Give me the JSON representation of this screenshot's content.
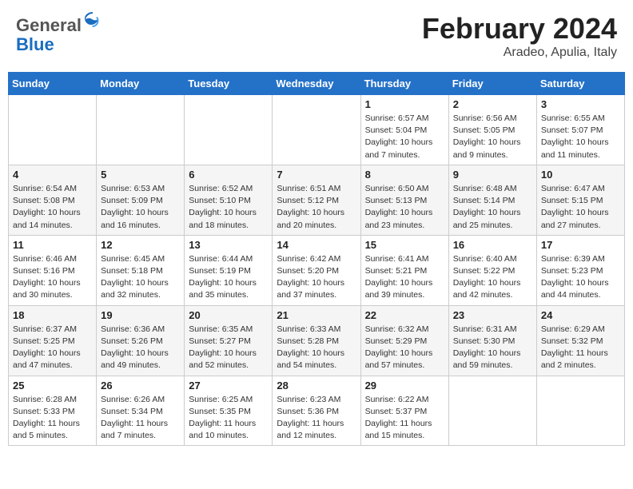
{
  "logo": {
    "general": "General",
    "blue": "Blue"
  },
  "header": {
    "month": "February 2024",
    "location": "Aradeo, Apulia, Italy"
  },
  "weekdays": [
    "Sunday",
    "Monday",
    "Tuesday",
    "Wednesday",
    "Thursday",
    "Friday",
    "Saturday"
  ],
  "weeks": [
    [
      {
        "day": "",
        "info": ""
      },
      {
        "day": "",
        "info": ""
      },
      {
        "day": "",
        "info": ""
      },
      {
        "day": "",
        "info": ""
      },
      {
        "day": "1",
        "info": "Sunrise: 6:57 AM\nSunset: 5:04 PM\nDaylight: 10 hours\nand 7 minutes."
      },
      {
        "day": "2",
        "info": "Sunrise: 6:56 AM\nSunset: 5:05 PM\nDaylight: 10 hours\nand 9 minutes."
      },
      {
        "day": "3",
        "info": "Sunrise: 6:55 AM\nSunset: 5:07 PM\nDaylight: 10 hours\nand 11 minutes."
      }
    ],
    [
      {
        "day": "4",
        "info": "Sunrise: 6:54 AM\nSunset: 5:08 PM\nDaylight: 10 hours\nand 14 minutes."
      },
      {
        "day": "5",
        "info": "Sunrise: 6:53 AM\nSunset: 5:09 PM\nDaylight: 10 hours\nand 16 minutes."
      },
      {
        "day": "6",
        "info": "Sunrise: 6:52 AM\nSunset: 5:10 PM\nDaylight: 10 hours\nand 18 minutes."
      },
      {
        "day": "7",
        "info": "Sunrise: 6:51 AM\nSunset: 5:12 PM\nDaylight: 10 hours\nand 20 minutes."
      },
      {
        "day": "8",
        "info": "Sunrise: 6:50 AM\nSunset: 5:13 PM\nDaylight: 10 hours\nand 23 minutes."
      },
      {
        "day": "9",
        "info": "Sunrise: 6:48 AM\nSunset: 5:14 PM\nDaylight: 10 hours\nand 25 minutes."
      },
      {
        "day": "10",
        "info": "Sunrise: 6:47 AM\nSunset: 5:15 PM\nDaylight: 10 hours\nand 27 minutes."
      }
    ],
    [
      {
        "day": "11",
        "info": "Sunrise: 6:46 AM\nSunset: 5:16 PM\nDaylight: 10 hours\nand 30 minutes."
      },
      {
        "day": "12",
        "info": "Sunrise: 6:45 AM\nSunset: 5:18 PM\nDaylight: 10 hours\nand 32 minutes."
      },
      {
        "day": "13",
        "info": "Sunrise: 6:44 AM\nSunset: 5:19 PM\nDaylight: 10 hours\nand 35 minutes."
      },
      {
        "day": "14",
        "info": "Sunrise: 6:42 AM\nSunset: 5:20 PM\nDaylight: 10 hours\nand 37 minutes."
      },
      {
        "day": "15",
        "info": "Sunrise: 6:41 AM\nSunset: 5:21 PM\nDaylight: 10 hours\nand 39 minutes."
      },
      {
        "day": "16",
        "info": "Sunrise: 6:40 AM\nSunset: 5:22 PM\nDaylight: 10 hours\nand 42 minutes."
      },
      {
        "day": "17",
        "info": "Sunrise: 6:39 AM\nSunset: 5:23 PM\nDaylight: 10 hours\nand 44 minutes."
      }
    ],
    [
      {
        "day": "18",
        "info": "Sunrise: 6:37 AM\nSunset: 5:25 PM\nDaylight: 10 hours\nand 47 minutes."
      },
      {
        "day": "19",
        "info": "Sunrise: 6:36 AM\nSunset: 5:26 PM\nDaylight: 10 hours\nand 49 minutes."
      },
      {
        "day": "20",
        "info": "Sunrise: 6:35 AM\nSunset: 5:27 PM\nDaylight: 10 hours\nand 52 minutes."
      },
      {
        "day": "21",
        "info": "Sunrise: 6:33 AM\nSunset: 5:28 PM\nDaylight: 10 hours\nand 54 minutes."
      },
      {
        "day": "22",
        "info": "Sunrise: 6:32 AM\nSunset: 5:29 PM\nDaylight: 10 hours\nand 57 minutes."
      },
      {
        "day": "23",
        "info": "Sunrise: 6:31 AM\nSunset: 5:30 PM\nDaylight: 10 hours\nand 59 minutes."
      },
      {
        "day": "24",
        "info": "Sunrise: 6:29 AM\nSunset: 5:32 PM\nDaylight: 11 hours\nand 2 minutes."
      }
    ],
    [
      {
        "day": "25",
        "info": "Sunrise: 6:28 AM\nSunset: 5:33 PM\nDaylight: 11 hours\nand 5 minutes."
      },
      {
        "day": "26",
        "info": "Sunrise: 6:26 AM\nSunset: 5:34 PM\nDaylight: 11 hours\nand 7 minutes."
      },
      {
        "day": "27",
        "info": "Sunrise: 6:25 AM\nSunset: 5:35 PM\nDaylight: 11 hours\nand 10 minutes."
      },
      {
        "day": "28",
        "info": "Sunrise: 6:23 AM\nSunset: 5:36 PM\nDaylight: 11 hours\nand 12 minutes."
      },
      {
        "day": "29",
        "info": "Sunrise: 6:22 AM\nSunset: 5:37 PM\nDaylight: 11 hours\nand 15 minutes."
      },
      {
        "day": "",
        "info": ""
      },
      {
        "day": "",
        "info": ""
      }
    ]
  ]
}
